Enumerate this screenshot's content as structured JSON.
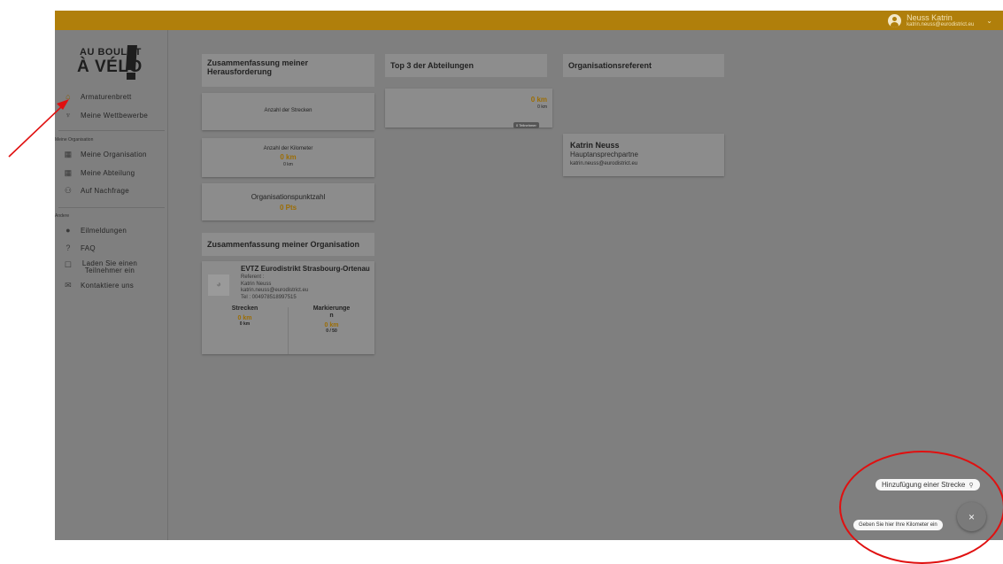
{
  "user": {
    "name": "Neuss Katrin",
    "email": "katrin.neuss@eurodistrict.eu"
  },
  "logo": {
    "line1": "AU BOULOT",
    "line2": "À VÉLO"
  },
  "sidebar": {
    "items": [
      {
        "label": "Armaturenbrett",
        "icon": "home-icon"
      },
      {
        "label": "Meine Wettbewerbe",
        "icon": "trophy-icon"
      }
    ],
    "section_org": "Meine Organisation",
    "org_items": [
      {
        "label": "Meine Organisation",
        "icon": "building-icon"
      },
      {
        "label": "Meine Abteilung",
        "icon": "building-icon"
      },
      {
        "label": "Auf Nachfrage",
        "icon": "group-icon"
      }
    ],
    "section_other": "Andere",
    "other_items": [
      {
        "label": "Eilmeldungen",
        "icon": "info-icon"
      },
      {
        "label": "FAQ",
        "icon": "help-icon"
      },
      {
        "label": "Laden Sie einen Teilnehmer ein",
        "icon": "edit-icon"
      },
      {
        "label": "Kontaktiere uns",
        "icon": "mail-icon"
      }
    ]
  },
  "challenge": {
    "title": "Zusammenfassung meiner Herausforderung",
    "routes_label": "Anzahl der Strecken",
    "km_label": "Anzahl der Kilometer",
    "km_value": "0 km",
    "km_sub": "0 km",
    "points_label": "Organisationspunktzahl",
    "points_value": "0 Pts"
  },
  "top3": {
    "title": "Top 3 der Abteilungen",
    "km_value": "0 km",
    "km_sub": "0 km",
    "participants": "0 Teilnehmer"
  },
  "referent_section": {
    "title": "Organisationsreferent",
    "name": "Katrin Neuss",
    "role": "Hauptansprechpartne",
    "email": "katrin.neuss@eurodistrict.eu"
  },
  "org_summary": {
    "title": "Zusammenfassung meiner Organisation",
    "org_name": "EVTZ Eurodistrikt Strasbourg-Ortenau",
    "referent_label": "Referent :",
    "referent_name": "Katrin Neuss",
    "referent_email": "katrin.neuss@eurodistrict.eu",
    "phone": "Tel : 004978518997515",
    "col1_title": "Strecken",
    "col1_value": "0 km",
    "col1_sub": "0 km",
    "col2_title": "Markierunge\nn",
    "col2_value": "0 km",
    "col2_sub": "0 / 50"
  },
  "fab": {
    "add_route": "Hinzufügung einer Strecke",
    "enter_km": "Geben Sie hier Ihre Kilometer ein",
    "close": "×"
  },
  "colors": {
    "topbar": "#b07f0b",
    "accent": "#9c6d04",
    "annotation": "#e01010"
  }
}
